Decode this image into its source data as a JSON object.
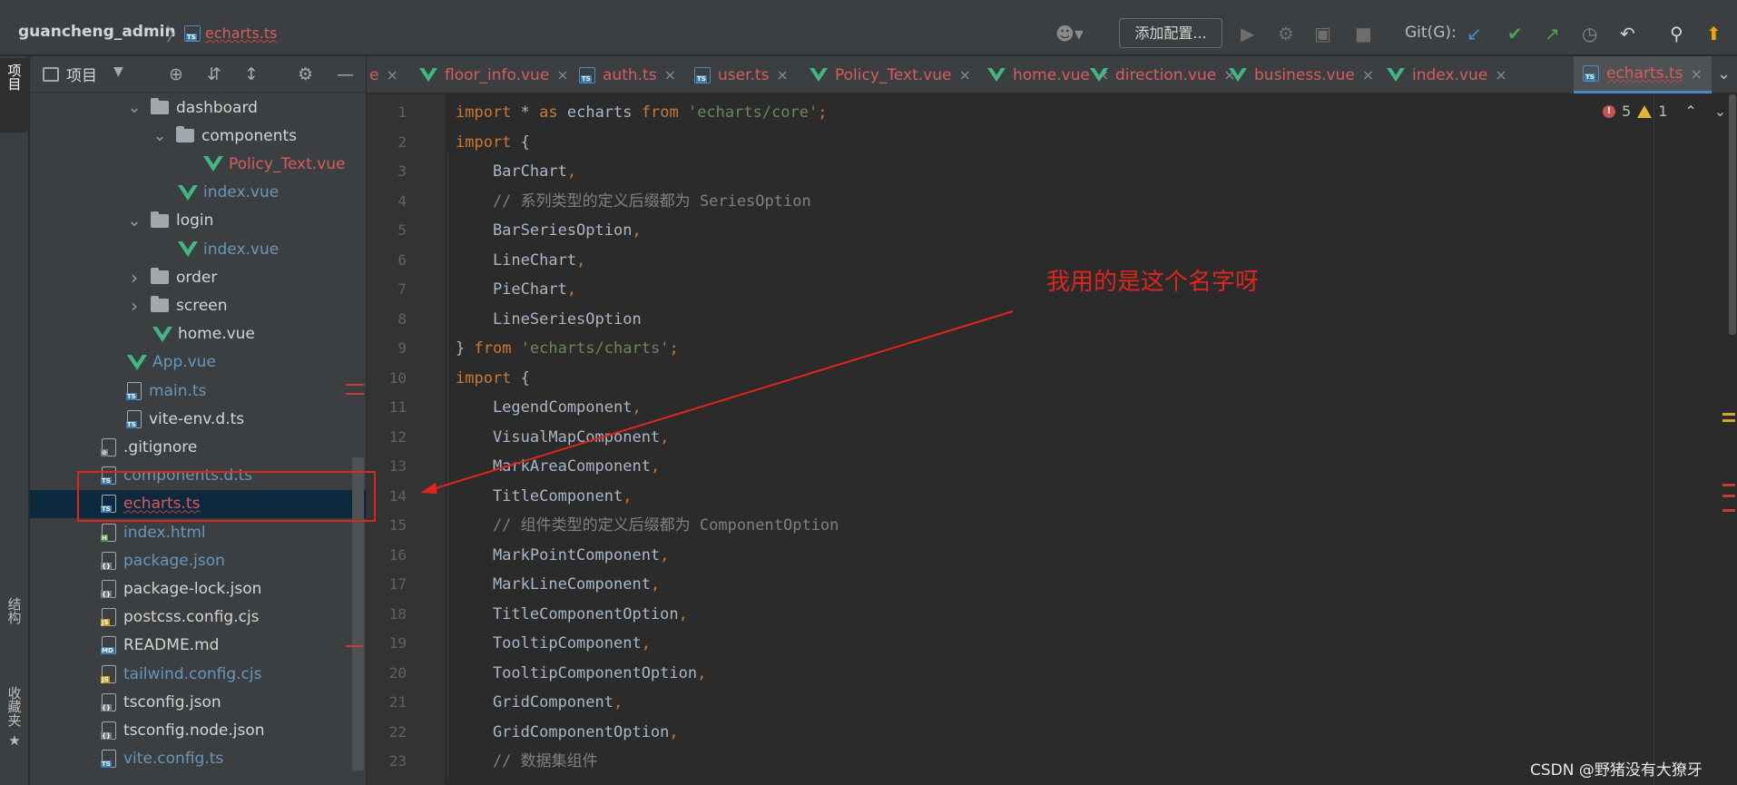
{
  "toolbar": {
    "project_name": "guancheng_admin",
    "breadcrumb_file": "echarts.ts",
    "config_button": "添加配置...",
    "git_label": "Git(G):"
  },
  "left_stripe": {
    "project_tab": "项目",
    "structure_tab": "结构",
    "bookmarks_tab": "收藏夹"
  },
  "project_panel": {
    "title": "项目",
    "tree": [
      {
        "label": "dashboard",
        "type": "folder",
        "expanded": true,
        "color": "white"
      },
      {
        "label": "components",
        "type": "folder",
        "expanded": true,
        "color": "white"
      },
      {
        "label": "Policy_Text.vue",
        "type": "vue",
        "color": "red"
      },
      {
        "label": "index.vue",
        "type": "vue",
        "color": "blue"
      },
      {
        "label": "login",
        "type": "folder",
        "expanded": true,
        "color": "white"
      },
      {
        "label": "index.vue",
        "type": "vue",
        "color": "blue"
      },
      {
        "label": "order",
        "type": "folder",
        "expanded": false,
        "color": "white"
      },
      {
        "label": "screen",
        "type": "folder",
        "expanded": false,
        "color": "white"
      },
      {
        "label": "home.vue",
        "type": "vue",
        "color": "white"
      },
      {
        "label": "App.vue",
        "type": "vue",
        "color": "blue"
      },
      {
        "label": "main.ts",
        "type": "ts",
        "color": "blue"
      },
      {
        "label": "vite-env.d.ts",
        "type": "ts",
        "color": "white"
      },
      {
        "label": ".gitignore",
        "type": "file",
        "color": "white"
      },
      {
        "label": "components.d.ts",
        "type": "ts",
        "color": "blue"
      },
      {
        "label": "echarts.ts",
        "type": "ts",
        "color": "red",
        "selected": true
      },
      {
        "label": "index.html",
        "type": "html",
        "color": "blue"
      },
      {
        "label": "package.json",
        "type": "json",
        "color": "blue"
      },
      {
        "label": "package-lock.json",
        "type": "json",
        "color": "white"
      },
      {
        "label": "postcss.config.cjs",
        "type": "js",
        "color": "white"
      },
      {
        "label": "README.md",
        "type": "md",
        "color": "white"
      },
      {
        "label": "tailwind.config.cjs",
        "type": "js",
        "color": "blue"
      },
      {
        "label": "tsconfig.json",
        "type": "json",
        "color": "white"
      },
      {
        "label": "tsconfig.node.json",
        "type": "json",
        "color": "white"
      },
      {
        "label": "vite.config.ts",
        "type": "ts",
        "color": "blue"
      }
    ]
  },
  "tabs": [
    {
      "label": "e",
      "type": "partial"
    },
    {
      "label": "floor_info.vue",
      "type": "vue"
    },
    {
      "label": "auth.ts",
      "type": "ts"
    },
    {
      "label": "user.ts",
      "type": "ts"
    },
    {
      "label": "Policy_Text.vue",
      "type": "vue"
    },
    {
      "label": "home.vue",
      "type": "vue"
    },
    {
      "label": "direction.vue",
      "type": "vue"
    },
    {
      "label": "business.vue",
      "type": "vue"
    },
    {
      "label": "index.vue",
      "type": "vue"
    },
    {
      "label": "echarts.ts",
      "type": "ts",
      "active": true
    }
  ],
  "inspection": {
    "errors": "5",
    "warnings": "1"
  },
  "code_lines": [
    {
      "n": "1",
      "tokens": [
        [
          "kw",
          "import"
        ],
        [
          "t",
          " * "
        ],
        [
          "kw",
          "as"
        ],
        [
          "t",
          " echarts "
        ],
        [
          "kw",
          "from"
        ],
        [
          "t",
          " "
        ],
        [
          "str",
          "'echarts/core'"
        ],
        [
          "kw",
          ";"
        ]
      ]
    },
    {
      "n": "2",
      "tokens": [
        [
          "kw",
          "import"
        ],
        [
          "t",
          " {"
        ]
      ]
    },
    {
      "n": "3",
      "tokens": [
        [
          "t",
          "    BarChart"
        ],
        [
          "kw",
          ","
        ]
      ]
    },
    {
      "n": "4",
      "tokens": [
        [
          "cm",
          "    // 系列类型的定义后缀都为 SeriesOption"
        ]
      ]
    },
    {
      "n": "5",
      "tokens": [
        [
          "t",
          "    BarSeriesOption"
        ],
        [
          "kw",
          ","
        ]
      ]
    },
    {
      "n": "6",
      "tokens": [
        [
          "t",
          "    LineChart"
        ],
        [
          "kw",
          ","
        ]
      ]
    },
    {
      "n": "7",
      "tokens": [
        [
          "t",
          "    PieChart"
        ],
        [
          "kw",
          ","
        ]
      ]
    },
    {
      "n": "8",
      "tokens": [
        [
          "t",
          "    LineSeriesOption"
        ]
      ]
    },
    {
      "n": "9",
      "tokens": [
        [
          "t",
          "} "
        ],
        [
          "kw",
          "from"
        ],
        [
          "t",
          " "
        ],
        [
          "str",
          "'echarts/charts'"
        ],
        [
          "kw",
          ";"
        ]
      ]
    },
    {
      "n": "10",
      "tokens": [
        [
          "kw",
          "import"
        ],
        [
          "t",
          " {"
        ]
      ]
    },
    {
      "n": "11",
      "tokens": [
        [
          "t",
          "    LegendComponent"
        ],
        [
          "kw",
          ","
        ]
      ]
    },
    {
      "n": "12",
      "tokens": [
        [
          "t",
          "    VisualMapComponent"
        ],
        [
          "kw",
          ","
        ]
      ]
    },
    {
      "n": "13",
      "tokens": [
        [
          "t",
          "    MarkAreaComponent"
        ],
        [
          "kw",
          ","
        ]
      ]
    },
    {
      "n": "14",
      "tokens": [
        [
          "t",
          "    TitleComponent"
        ],
        [
          "kw",
          ","
        ]
      ]
    },
    {
      "n": "15",
      "tokens": [
        [
          "cm",
          "    // 组件类型的定义后缀都为 ComponentOption"
        ]
      ]
    },
    {
      "n": "16",
      "tokens": [
        [
          "t",
          "    MarkPointComponent"
        ],
        [
          "kw",
          ","
        ]
      ]
    },
    {
      "n": "17",
      "tokens": [
        [
          "t",
          "    MarkLineComponent"
        ],
        [
          "kw",
          ","
        ]
      ]
    },
    {
      "n": "18",
      "tokens": [
        [
          "t",
          "    TitleComponentOption"
        ],
        [
          "kw",
          ","
        ]
      ]
    },
    {
      "n": "19",
      "tokens": [
        [
          "t",
          "    TooltipComponent"
        ],
        [
          "kw",
          ","
        ]
      ]
    },
    {
      "n": "20",
      "tokens": [
        [
          "t",
          "    TooltipComponentOption"
        ],
        [
          "kw",
          ","
        ]
      ]
    },
    {
      "n": "21",
      "tokens": [
        [
          "t",
          "    GridComponent"
        ],
        [
          "kw",
          ","
        ]
      ]
    },
    {
      "n": "22",
      "tokens": [
        [
          "t",
          "    GridComponentOption"
        ],
        [
          "kw",
          ","
        ]
      ]
    },
    {
      "n": "23",
      "tokens": [
        [
          "cm",
          "    // 数据集组件"
        ]
      ]
    }
  ],
  "annotation": {
    "text": "我用的是这个名字呀"
  },
  "watermark": "CSDN @野猪没有大獠牙",
  "colors": {
    "keyword": "#cc7832",
    "string": "#6a8759",
    "comment": "#808080",
    "error_red": "#e0251d",
    "vue_green": "#41b883"
  }
}
